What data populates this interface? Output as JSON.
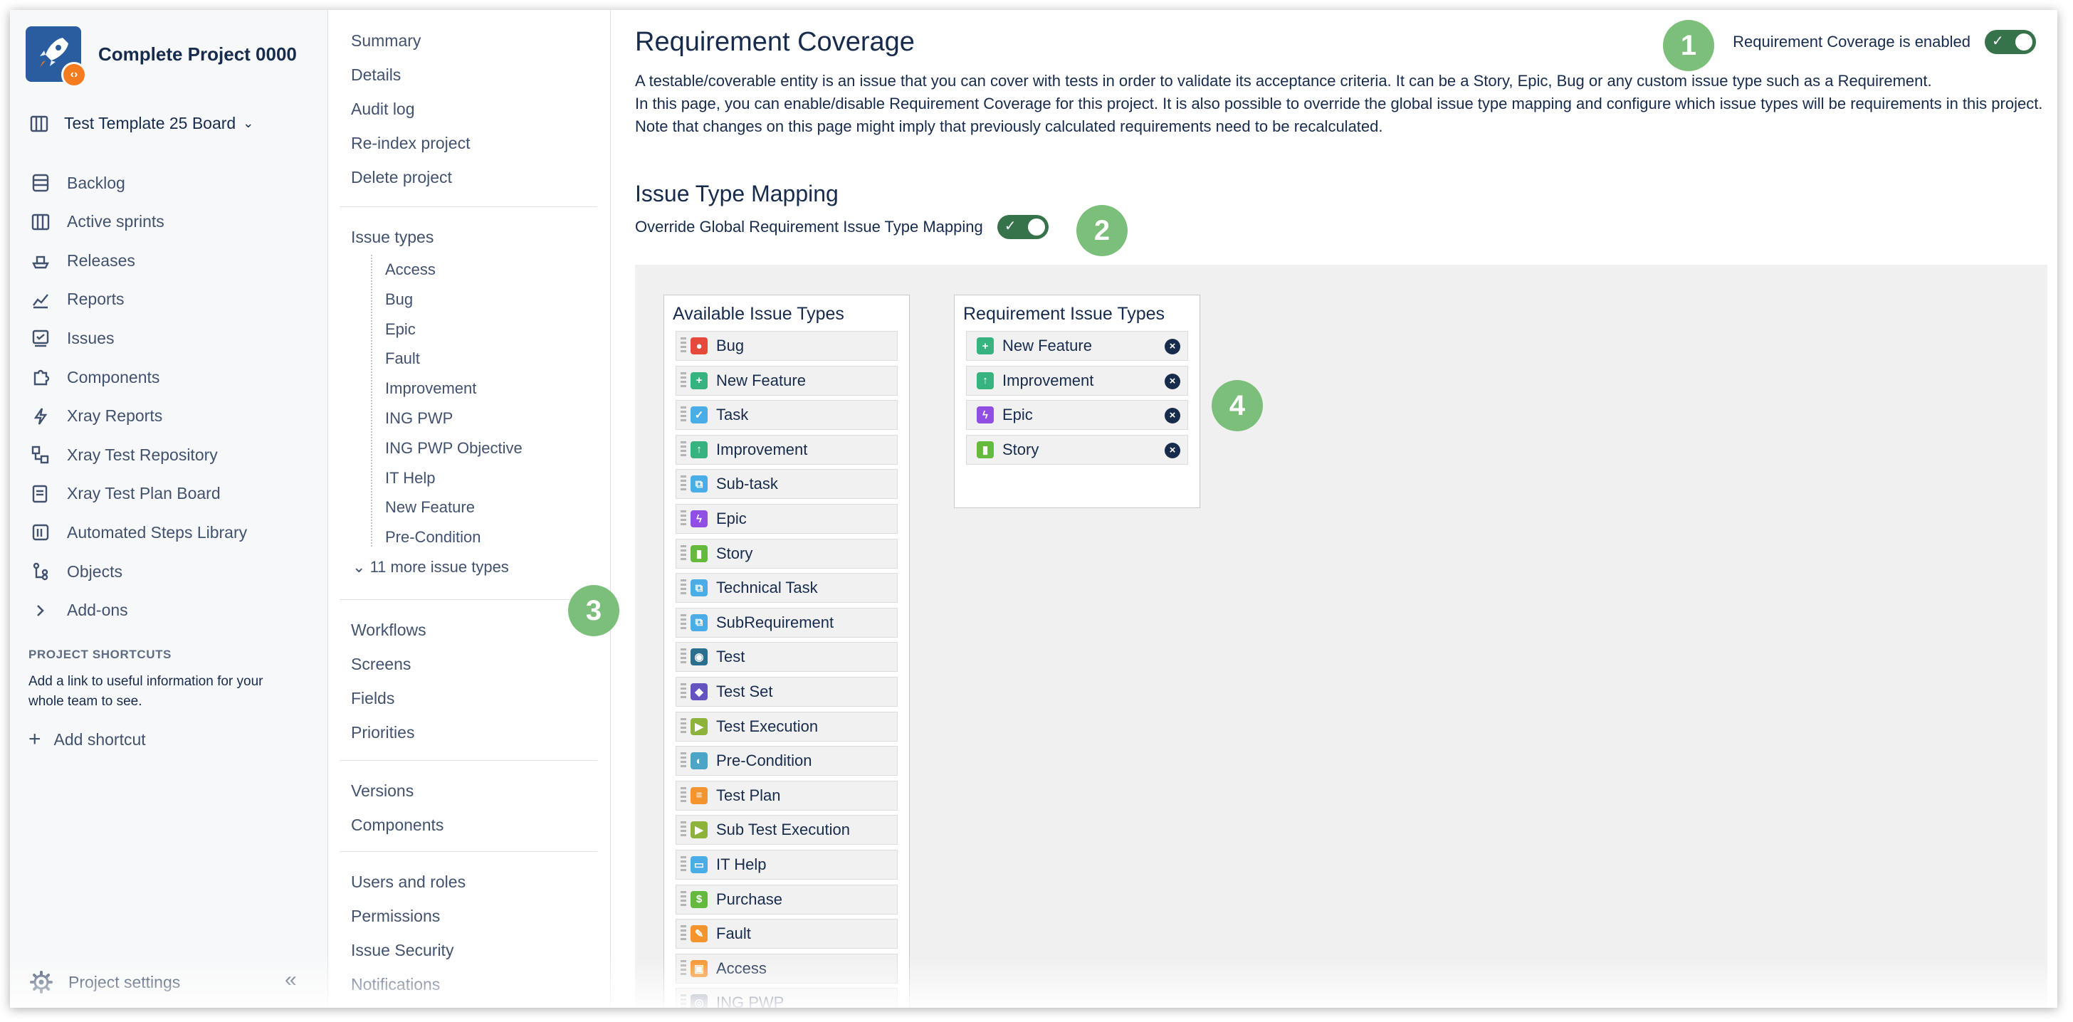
{
  "project": {
    "name": "Complete Project 0000"
  },
  "board": {
    "name": "Test Template 25 Board"
  },
  "sidebar": {
    "items": [
      {
        "label": "Backlog",
        "icon": "backlog-icon"
      },
      {
        "label": "Active sprints",
        "icon": "board-icon"
      },
      {
        "label": "Releases",
        "icon": "ship-icon"
      },
      {
        "label": "Reports",
        "icon": "chart-icon"
      },
      {
        "label": "Issues",
        "icon": "issues-icon"
      },
      {
        "label": "Components",
        "icon": "puzzle-icon"
      },
      {
        "label": "Xray Reports",
        "icon": "bolt-icon"
      },
      {
        "label": "Xray Test Repository",
        "icon": "repository-icon"
      },
      {
        "label": "Xray Test Plan Board",
        "icon": "plan-icon"
      },
      {
        "label": "Automated Steps Library",
        "icon": "library-icon"
      },
      {
        "label": "Objects",
        "icon": "objects-icon"
      },
      {
        "label": "Add-ons",
        "icon": "chevron-right-icon"
      }
    ],
    "shortcuts_title": "PROJECT SHORTCUTS",
    "shortcuts_desc": "Add a link to useful information for your whole team to see.",
    "add_shortcut": "Add shortcut",
    "project_settings": "Project settings"
  },
  "subnav": {
    "group1": [
      "Summary",
      "Details",
      "Audit log",
      "Re-index project",
      "Delete project"
    ],
    "issue_types_title": "Issue types",
    "issue_types": [
      "Access",
      "Bug",
      "Epic",
      "Fault",
      "Improvement",
      "ING PWP",
      "ING PWP Objective",
      "IT Help",
      "New Feature",
      "Pre-Condition"
    ],
    "more": "11 more issue types",
    "group2": [
      "Workflows",
      "Screens",
      "Fields",
      "Priorities"
    ],
    "group3": [
      "Versions",
      "Components"
    ],
    "group4": [
      "Users and roles",
      "Permissions",
      "Issue Security",
      "Notifications"
    ]
  },
  "main": {
    "title": "Requirement Coverage",
    "coverage_label": "Requirement Coverage is enabled",
    "coverage_enabled": true,
    "desc": [
      "A testable/coverable entity is an issue that you can cover with tests in order to validate its acceptance criteria. It can be a Story, Epic, Bug or any custom issue type such as a Requirement.",
      "In this page, you can enable/disable Requirement Coverage for this project. It is also possible to override the global issue type mapping and configure which issue types will be requirements in this project.",
      "Note that changes on this page might imply that previously calculated requirements need to be recalculated."
    ],
    "mapping_title": "Issue Type Mapping",
    "override_label": "Override Global Requirement Issue Type Mapping",
    "override_enabled": true,
    "callouts": [
      "1",
      "2",
      "3",
      "4"
    ],
    "available_title": "Available Issue Types",
    "available": [
      {
        "label": "Bug",
        "color": "#e5493a",
        "glyph": "●"
      },
      {
        "label": "New Feature",
        "color": "#36b37e",
        "glyph": "+"
      },
      {
        "label": "Task",
        "color": "#4bade8",
        "glyph": "✓"
      },
      {
        "label": "Improvement",
        "color": "#36b37e",
        "glyph": "↑"
      },
      {
        "label": "Sub-task",
        "color": "#4bade8",
        "glyph": "⧉"
      },
      {
        "label": "Epic",
        "color": "#904ee2",
        "glyph": "ϟ"
      },
      {
        "label": "Story",
        "color": "#63ba3c",
        "glyph": "▮"
      },
      {
        "label": "Technical Task",
        "color": "#4bade8",
        "glyph": "⧉"
      },
      {
        "label": "SubRequirement",
        "color": "#4bade8",
        "glyph": "⧉"
      },
      {
        "label": "Test",
        "color": "#2b6f8f",
        "glyph": "◉"
      },
      {
        "label": "Test Set",
        "color": "#6554c0",
        "glyph": "◆"
      },
      {
        "label": "Test Execution",
        "color": "#8db33a",
        "glyph": "▶"
      },
      {
        "label": "Pre-Condition",
        "color": "#4aa5c6",
        "glyph": "◐"
      },
      {
        "label": "Test Plan",
        "color": "#f4942f",
        "glyph": "≡"
      },
      {
        "label": "Sub Test Execution",
        "color": "#8db33a",
        "glyph": "▶"
      },
      {
        "label": "IT Help",
        "color": "#4bade8",
        "glyph": "▭"
      },
      {
        "label": "Purchase",
        "color": "#63ba3c",
        "glyph": "$"
      },
      {
        "label": "Fault",
        "color": "#f4942f",
        "glyph": "✎"
      },
      {
        "label": "Access",
        "color": "#f4942f",
        "glyph": "▣"
      },
      {
        "label": "ING PWP",
        "color": "#7a869a",
        "glyph": "◎"
      }
    ],
    "requirement_title": "Requirement Issue Types",
    "requirement": [
      {
        "label": "New Feature",
        "color": "#36b37e",
        "glyph": "+"
      },
      {
        "label": "Improvement",
        "color": "#36b37e",
        "glyph": "↑"
      },
      {
        "label": "Epic",
        "color": "#904ee2",
        "glyph": "ϟ"
      },
      {
        "label": "Story",
        "color": "#63ba3c",
        "glyph": "▮"
      }
    ]
  }
}
